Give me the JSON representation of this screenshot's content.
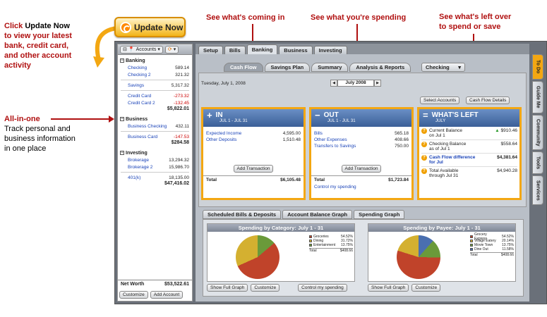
{
  "callouts": {
    "update_l1a": "Click ",
    "update_l1b": "Update Now",
    "update_l2": "to view your latest",
    "update_l3": "bank, credit card,",
    "update_l4": "and other account",
    "update_l5": "activity",
    "allinone_title": "All-in-one",
    "allinone_l1": "Track personal and",
    "allinone_l2": "business information",
    "allinone_l3": "in one place",
    "coming_in": "See what's coming in",
    "spending": "See what you're spending",
    "left_l1": "See what's left over",
    "left_l2": "to spend or save"
  },
  "update_button": "Update Now",
  "sidebar": {
    "accounts_label": "Accounts",
    "groups": [
      {
        "title": "Banking",
        "accounts": [
          {
            "name": "Checking",
            "value": "589.14",
            "neg": false
          },
          {
            "name": "Checking 2",
            "value": "321.32",
            "neg": false
          },
          {
            "name": "Savings",
            "value": "5,317.32",
            "neg": false
          },
          {
            "name": "Credit Card",
            "value": "-273.32",
            "neg": true
          },
          {
            "name": "Credit Card 2",
            "value": "-132.45",
            "neg": true
          }
        ],
        "total": "$5,822.01"
      },
      {
        "title": "Business",
        "accounts": [
          {
            "name": "Business Checking",
            "value": "432.11",
            "neg": false
          },
          {
            "name": "Business Card",
            "value": "-147.53",
            "neg": true
          }
        ],
        "total": "$284.58"
      },
      {
        "title": "Investing",
        "accounts": [
          {
            "name": "Brokerage",
            "value": "13,294.32",
            "neg": false
          },
          {
            "name": "Brokerage 2",
            "value": "15,986.70",
            "neg": false
          },
          {
            "name": "401(k)",
            "value": "18,135.00",
            "neg": false
          }
        ],
        "total": "$47,416.02"
      }
    ],
    "net_worth_label": "Net Worth",
    "net_worth_value": "$53,522.61",
    "customize": "Customize",
    "add_account": "Add Account"
  },
  "top_tabs": [
    "Setup",
    "Bills",
    "Banking",
    "Business",
    "Investing"
  ],
  "sub_tabs": [
    "Cash Flow",
    "Savings Plan",
    "Summary",
    "Analysis & Reports"
  ],
  "account_select": "Checking",
  "date": "Tuesday, July 1, 2008",
  "month": "July 2008",
  "select_accounts": "Select Accounts",
  "cash_flow_details": "Cash Flow Details",
  "in_card": {
    "title": "IN",
    "sub": "JUL 1 - JUL 31",
    "rows": [
      {
        "name": "Expected Income",
        "value": "4,595.00"
      },
      {
        "name": "Other Deposits",
        "value": "1,510.48"
      }
    ],
    "add_tx": "Add Transaction",
    "total_label": "Total",
    "total": "$6,105.48"
  },
  "out_card": {
    "title": "OUT",
    "sub": "JUL 1 - JUL 31",
    "rows": [
      {
        "name": "Bills",
        "value": "565.18"
      },
      {
        "name": "Other Expenses",
        "value": "408.66"
      },
      {
        "name": "Transfers to Savings",
        "value": "750.00"
      }
    ],
    "add_tx": "Add Transaction",
    "total_label": "Total",
    "total": "$1,723.84",
    "control": "Control my spending"
  },
  "left_card": {
    "title": "WHAT'S LEFT",
    "sub": "JULY",
    "rows": [
      {
        "l1": "Current Balance",
        "l2": "on Jul 1",
        "value": "$910.46"
      },
      {
        "l1": "Checking Balance",
        "l2": "as of Jul 1",
        "value": "$558.64"
      },
      {
        "l1": "Cash Flow difference",
        "l2": "for Jul",
        "value": "$4,381.64"
      },
      {
        "l1": "Total Available",
        "l2": "through Jul 31",
        "value": "$4,940.28"
      }
    ]
  },
  "graph_tabs": [
    "Scheduled Bills & Deposits",
    "Account Balance Graph",
    "Spending Graph"
  ],
  "category_graph": {
    "title": "Spending by Category: July 1 - 31",
    "legend": [
      {
        "name": "Groceries",
        "pct": "54.52%",
        "color": "#c0432a"
      },
      {
        "name": "Dining",
        "pct": "31.72%",
        "color": "#d4b030"
      },
      {
        "name": "Entertainment",
        "pct": "13.75%",
        "color": "#6a9a3a"
      }
    ],
    "total_label": "Total",
    "total": "$408.66",
    "buttons": [
      "Show Full Graph",
      "Customize",
      "Control my spending"
    ]
  },
  "payee_graph": {
    "title": "Spending by Payee: July 1 - 31",
    "legend": [
      {
        "name": "Grocery Express",
        "pct": "54.52%",
        "color": "#c0432a"
      },
      {
        "name": "Village Eatery",
        "pct": "20.14%",
        "color": "#d4b030"
      },
      {
        "name": "Movie Town",
        "pct": "13.75%",
        "color": "#6a9a3a"
      },
      {
        "name": "Dine Out",
        "pct": "11.58%",
        "color": "#4a6fb0"
      }
    ],
    "total_label": "Total",
    "total": "$408.66",
    "buttons": [
      "Show Full Graph",
      "Customize"
    ]
  },
  "side_tabs": [
    "To Do",
    "Guide Me",
    "Community",
    "Tools",
    "Services"
  ]
}
